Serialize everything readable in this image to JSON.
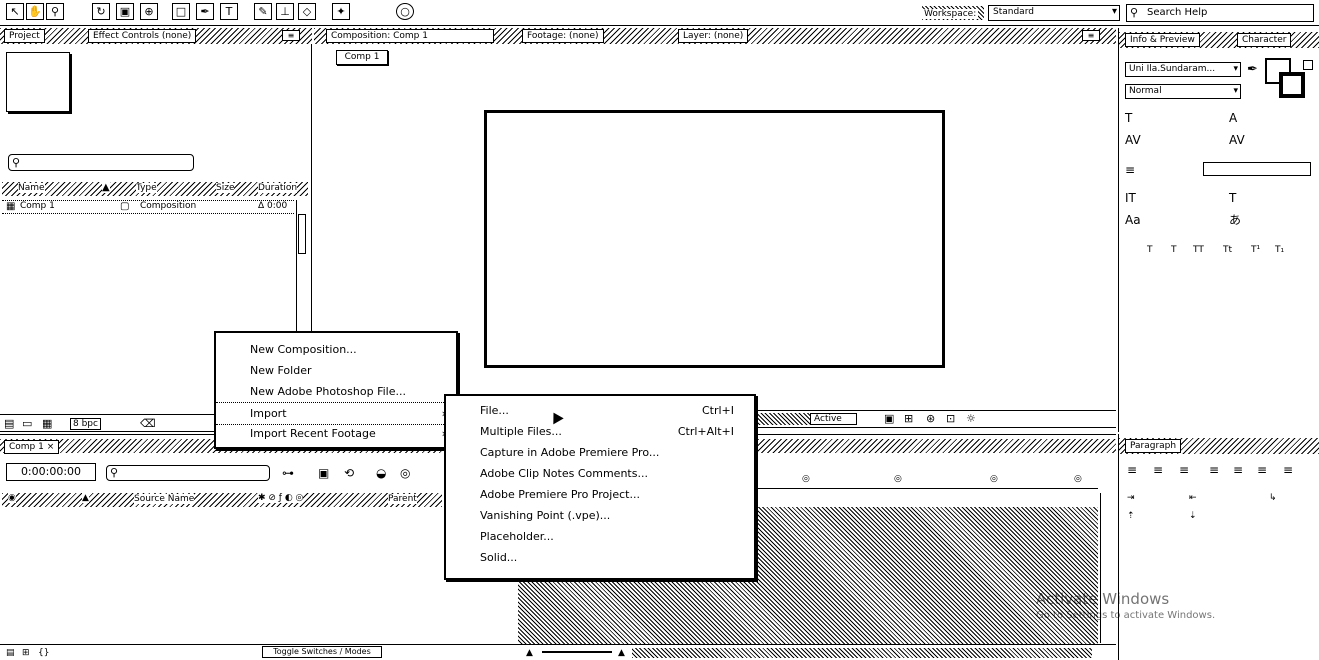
{
  "toolbar": {
    "workspace_label": "Workspace:",
    "workspace_value": "Standard",
    "search_help_placeholder": "Search Help"
  },
  "project_panel": {
    "tabs": [
      "Project",
      "Effect Controls (none)"
    ],
    "columns": [
      "Name",
      "Type",
      "Size",
      "Duration"
    ],
    "items": [
      {
        "name": "Comp 1",
        "type": "Composition",
        "duration": "Δ 0:00"
      }
    ],
    "bpc": "8 bpc"
  },
  "viewer": {
    "tabs": [
      "Composition: Comp 1",
      "Footage: (none)",
      "Layer: (none)"
    ],
    "comp_button": "Comp 1",
    "active_camera": "Active"
  },
  "character_panel": {
    "tabs": [
      "Info & Preview",
      "Character"
    ],
    "font": "Uni Ila.Sundaram...",
    "style": "Normal"
  },
  "paragraph_panel": {
    "tab": "Paragraph"
  },
  "timeline": {
    "tab": "Comp 1",
    "timecode": "0:00:00:00",
    "source_name_col": "Source Name",
    "parent_col": "Parent"
  },
  "bottom_bar": {
    "toggle_label": "Toggle Switches / Modes"
  },
  "watermark": {
    "line1": "Activate Windows",
    "line2": "Go to Settings to activate Windows."
  },
  "context_menu": {
    "items": [
      {
        "label": "New Composition..."
      },
      {
        "label": "New Folder"
      },
      {
        "label": "New Adobe Photoshop File..."
      },
      {
        "label": "Import",
        "arrow": "›"
      },
      {
        "label": "Import Recent Footage",
        "arrow": "›"
      }
    ]
  },
  "import_submenu": {
    "items": [
      {
        "label": "File...",
        "shortcut": "Ctrl+I"
      },
      {
        "label": "Multiple Files...",
        "shortcut": "Ctrl+Alt+I"
      },
      {
        "label": "Capture in Adobe Premiere Pro..."
      },
      {
        "label": "Adobe Clip Notes Comments..."
      },
      {
        "label": "Adobe Premiere Pro Project..."
      },
      {
        "label": "Vanishing Point (.vpe)..."
      },
      {
        "label": "Placeholder..."
      },
      {
        "label": "Solid..."
      }
    ]
  }
}
